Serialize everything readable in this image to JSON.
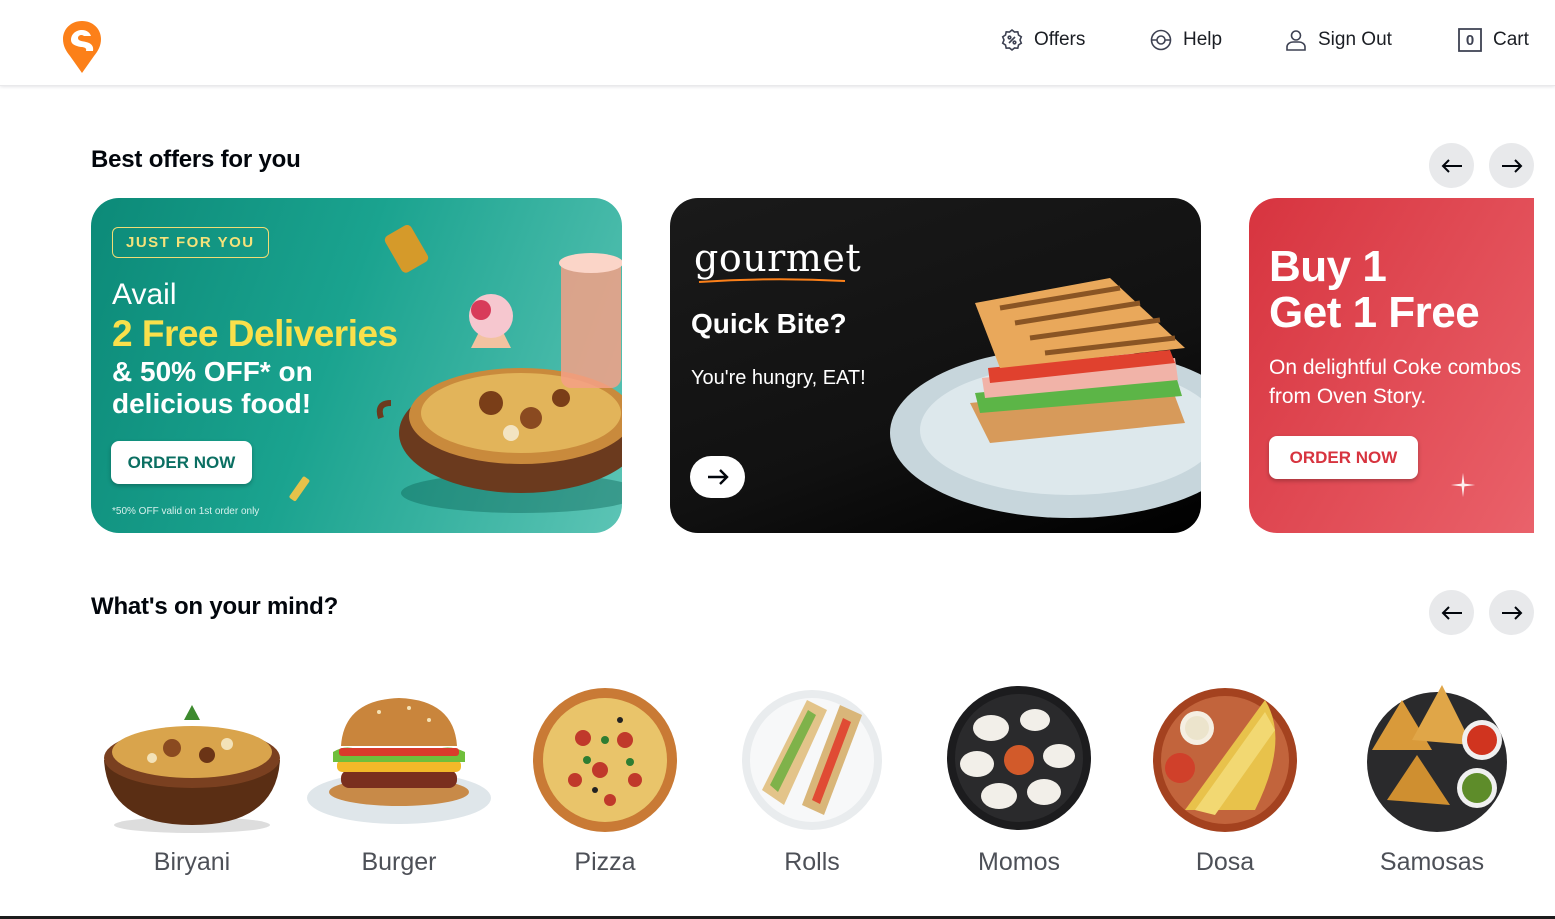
{
  "header": {
    "nav": [
      {
        "label": "Offers",
        "icon": "offers-icon"
      },
      {
        "label": "Help",
        "icon": "help-icon"
      },
      {
        "label": "Sign Out",
        "icon": "user-icon"
      },
      {
        "label": "Cart",
        "icon": "cart-icon",
        "count": "0"
      }
    ]
  },
  "offers": {
    "title": "Best offers for you",
    "cards": [
      {
        "tag": "JUST FOR YOU",
        "line1": "Avail",
        "line2": "2 Free Deliveries",
        "line3": "& 50% OFF* on delicious food!",
        "button": "ORDER NOW",
        "footnote": "*50% OFF valid on 1st order only"
      },
      {
        "brand": "gourmet",
        "title": "Quick Bite?",
        "subtitle": "You're hungry, EAT!"
      },
      {
        "title_line1": "Buy 1",
        "title_line2": "Get 1 Free",
        "subtitle": "On delightful Coke combos from Oven Story.",
        "button": "ORDER NOW"
      }
    ]
  },
  "mind": {
    "title": "What's on your mind?",
    "items": [
      "Biryani",
      "Burger",
      "Pizza",
      "Rolls",
      "Momos",
      "Dosa",
      "Samosas"
    ]
  },
  "colors": {
    "brand_orange": "#fc8019",
    "teal_card": "#1aa38f",
    "red_card": "#d7343f",
    "text_primary": "#02060c"
  }
}
